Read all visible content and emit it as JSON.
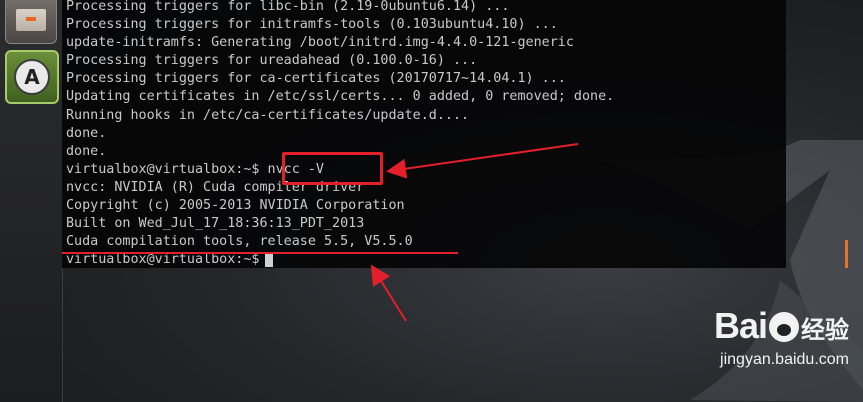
{
  "terminal": {
    "lines": [
      "Processing triggers for libc-bin (2.19-0ubuntu6.14) ...",
      "Processing triggers for initramfs-tools (0.103ubuntu4.10) ...",
      "update-initramfs: Generating /boot/initrd.img-4.4.0-121-generic",
      "Processing triggers for ureadahead (0.100.0-16) ...",
      "Processing triggers for ca-certificates (20170717~14.04.1) ...",
      "Updating certificates in /etc/ssl/certs... 0 added, 0 removed; done.",
      "Running hooks in /etc/ca-certificates/update.d....",
      "done.",
      "done.",
      "virtualbox@virtualbox:~$ nvcc -V",
      "nvcc: NVIDIA (R) Cuda compiler driver",
      "Copyright (c) 2005-2013 NVIDIA Corporation",
      "Built on Wed_Jul_17_18:36:13_PDT_2013",
      "Cuda compilation tools, release 5.5, V5.5.0"
    ],
    "prompt": "virtualbox@virtualbox:~$"
  },
  "launcher": {
    "items": [
      {
        "icon": "files-icon"
      },
      {
        "icon": "software-updater-icon",
        "letter": "A"
      }
    ]
  },
  "watermark": {
    "brand_left": "Bai",
    "brand_right": "经验",
    "url": "jingyan.baidu.com"
  },
  "colors": {
    "annotation_red": "#e3202a",
    "terminal_text": "#c9c9c9",
    "scroll_accent": "#e2722c"
  }
}
